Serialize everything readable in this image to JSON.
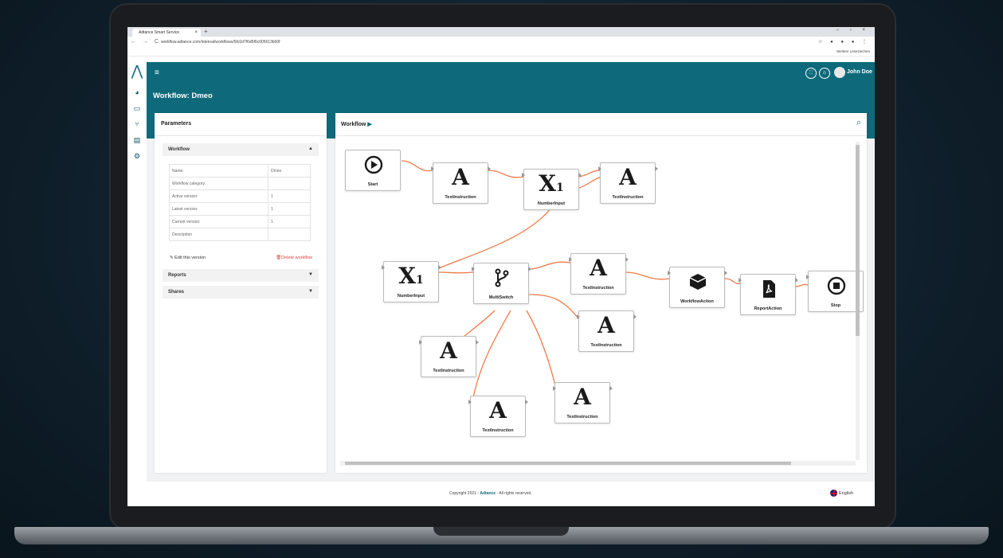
{
  "browser": {
    "tab_title": "Adtance Smart Service",
    "url": "workflow.adtance.com/internal/workflows/5fc0d7f6d5f6c005613b60f",
    "bookmark": "Weitere Lesezeichen"
  },
  "header": {
    "title": "Workflow: Dmeo",
    "user_name": "John Doe"
  },
  "params": {
    "panel_title": "Parameters",
    "workflow_section": "Workflow",
    "rows": [
      {
        "label": "Name:",
        "value": "Dmeo"
      },
      {
        "label": "Workflow category:",
        "value": ""
      },
      {
        "label": "Active version:",
        "value": "1"
      },
      {
        "label": "Latest version:",
        "value": "1"
      },
      {
        "label": "Current version:",
        "value": "1"
      },
      {
        "label": "Description",
        "value": ""
      }
    ],
    "edit_label": "Edit this version",
    "delete_label": "Delete workflow",
    "reports_section": "Reports",
    "shares_section": "Shares"
  },
  "workflow": {
    "panel_title": "Workflow",
    "nodes": [
      {
        "id": "start",
        "label": "Start",
        "icon": "play-circle-icon"
      },
      {
        "id": "ti1",
        "label": "TextInstruction",
        "icon": "A"
      },
      {
        "id": "ni1",
        "label": "NumberInput",
        "icon": "X1"
      },
      {
        "id": "ti2",
        "label": "TextInstruction",
        "icon": "A"
      },
      {
        "id": "ni2",
        "label": "NumberInput",
        "icon": "X1"
      },
      {
        "id": "ms",
        "label": "MultiSwitch",
        "icon": "branch-icon"
      },
      {
        "id": "ti3",
        "label": "TextInstruction",
        "icon": "A"
      },
      {
        "id": "wa",
        "label": "WorkflowAction",
        "icon": "cube-icon"
      },
      {
        "id": "ra",
        "label": "ReportAction",
        "icon": "pdf-icon"
      },
      {
        "id": "stop",
        "label": "Stop",
        "icon": "stop-circle-icon"
      },
      {
        "id": "ti4",
        "label": "TextInstruction",
        "icon": "A"
      },
      {
        "id": "ti5",
        "label": "TextInstruction",
        "icon": "A"
      },
      {
        "id": "ti6",
        "label": "TextInstruction",
        "icon": "A"
      },
      {
        "id": "ti7",
        "label": "TextInstruction",
        "icon": "A"
      }
    ],
    "edge_color": "#f07b4a"
  },
  "footer": {
    "copyright_prefix": "Copyright 2021 - ",
    "brand": "Adtance",
    "copyright_suffix": " - All rights reserved.",
    "language": "English"
  },
  "colors": {
    "header": "#0e6a7b",
    "edge": "#f07b4a",
    "delete": "#e0443c"
  }
}
